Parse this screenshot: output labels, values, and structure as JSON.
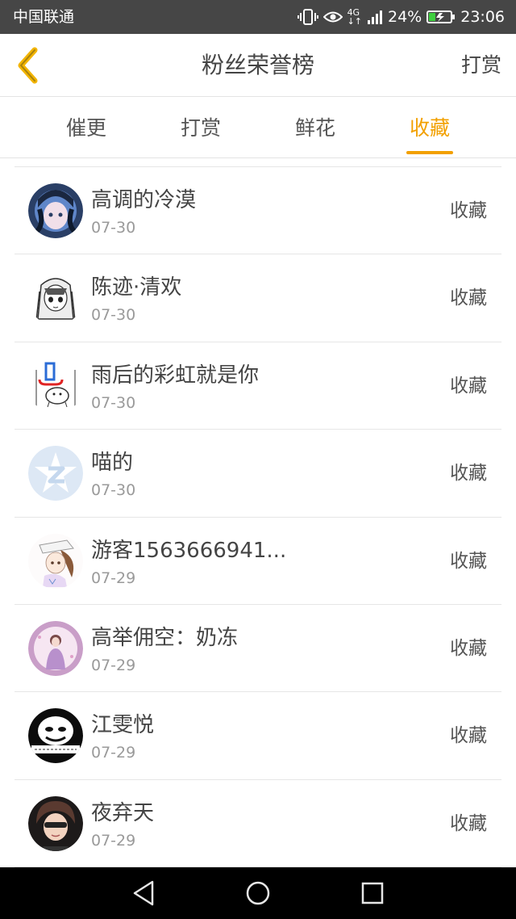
{
  "status_bar": {
    "carrier": "中国联通",
    "network_top": "4G",
    "network_bottom": "↓↑",
    "battery_percent": "24%",
    "time": "23:06",
    "icons": [
      "vibrate-icon",
      "eye-icon",
      "signal-icon",
      "battery-charging-icon"
    ]
  },
  "header": {
    "back_icon": "chevron-left-icon",
    "title": "粉丝荣誉榜",
    "action_label": "打赏"
  },
  "tabs": [
    {
      "label": "催更",
      "active": false
    },
    {
      "label": "打赏",
      "active": false
    },
    {
      "label": "鲜花",
      "active": false
    },
    {
      "label": "收藏",
      "active": true
    }
  ],
  "accent_color": "#f2a000",
  "fans": [
    {
      "name": "高调的冷漠",
      "date": "07-30",
      "action": "收藏"
    },
    {
      "name": "陈迹·清欢",
      "date": "07-30",
      "action": "收藏"
    },
    {
      "name": "雨后的彩虹就是你",
      "date": "07-30",
      "action": "收藏"
    },
    {
      "name": "喵的",
      "date": "07-30",
      "action": "收藏"
    },
    {
      "name": "游客1563666941...",
      "date": "07-29",
      "action": "收藏"
    },
    {
      "name": "高举佣空：奶冻",
      "date": "07-29",
      "action": "收藏"
    },
    {
      "name": "江雯悦",
      "date": "07-29",
      "action": "收藏"
    },
    {
      "name": "夜弃天",
      "date": "07-29",
      "action": "收藏"
    }
  ],
  "nav_bar": {
    "back": "triangle-back-icon",
    "home": "circle-home-icon",
    "recents": "square-recents-icon"
  }
}
